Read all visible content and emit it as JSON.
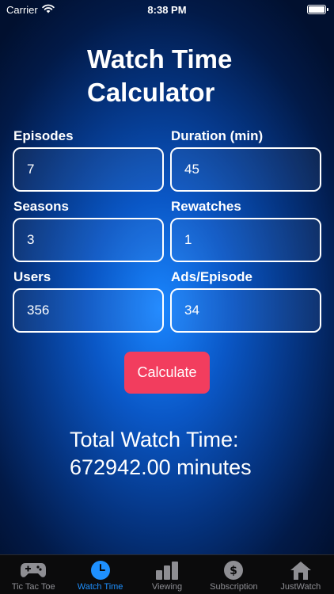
{
  "status_bar": {
    "carrier": "Carrier",
    "time": "8:38 PM"
  },
  "title": {
    "line1": "Watch Time",
    "line2": "Calculator"
  },
  "fields": {
    "episodes": {
      "label": "Episodes",
      "value": "7"
    },
    "duration": {
      "label": "Duration (min)",
      "value": "45"
    },
    "seasons": {
      "label": "Seasons",
      "value": "3"
    },
    "rewatches": {
      "label": "Rewatches",
      "value": "1"
    },
    "users": {
      "label": "Users",
      "value": "356"
    },
    "ads": {
      "label": "Ads/Episode",
      "value": "34"
    }
  },
  "calculate_button": {
    "label": "Calculate",
    "color": "#f23d5e"
  },
  "result": {
    "line1": "Total Watch Time:",
    "line2": "672942.00 minutes"
  },
  "tab_bar": {
    "active_color": "#1e90ff",
    "inactive_color": "#8e8e93",
    "tabs": [
      {
        "label": "Tic Tac Toe",
        "icon": "gamepad-icon",
        "active": false
      },
      {
        "label": "Watch Time",
        "icon": "clock-icon",
        "active": true
      },
      {
        "label": "Viewing",
        "icon": "bar-chart-icon",
        "active": false
      },
      {
        "label": "Subscription",
        "icon": "dollar-icon",
        "active": false
      },
      {
        "label": "JustWatch",
        "icon": "home-icon",
        "active": false
      }
    ]
  }
}
